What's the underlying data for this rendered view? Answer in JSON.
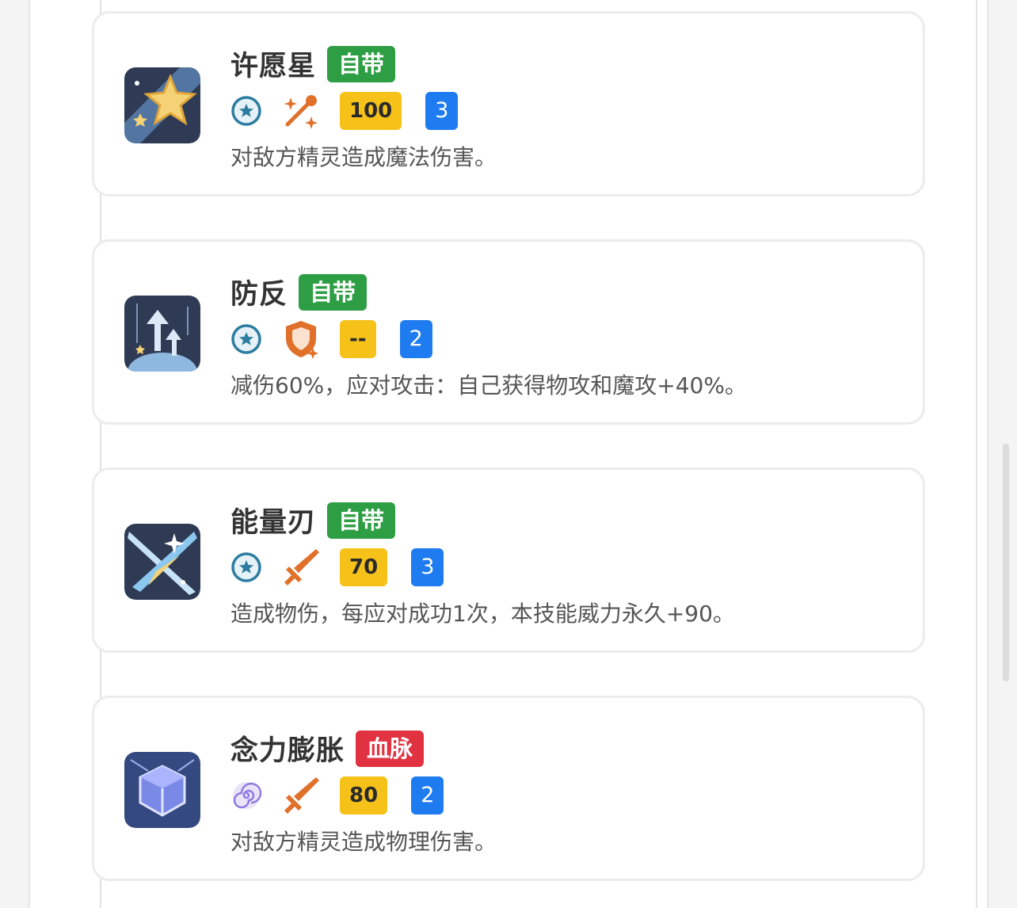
{
  "colors": {
    "tag_self": "#2e9e44",
    "tag_blood": "#e03241",
    "cost_bg": "#f6c21a",
    "pp_bg": "#1f7cf0",
    "type_orange": "#e0702a"
  },
  "skills": [
    {
      "name": "许愿星",
      "tag": "自带",
      "tag_type": "self",
      "element_icon": "star-circle-icon",
      "type_icon": "magic-sparkle-icon",
      "cost": "100",
      "pp": "3",
      "desc": "对敌方精灵造成魔法伤害。",
      "icon": "wish-star-icon"
    },
    {
      "name": "防反",
      "tag": "自带",
      "tag_type": "self",
      "element_icon": "star-circle-icon",
      "type_icon": "shield-icon",
      "cost": "--",
      "pp": "2",
      "desc": "减伤60%，应对攻击：自己获得物攻和魔攻+40%。",
      "icon": "counter-arrows-icon"
    },
    {
      "name": "能量刃",
      "tag": "自带",
      "tag_type": "self",
      "element_icon": "star-circle-icon",
      "type_icon": "sword-icon",
      "cost": "70",
      "pp": "3",
      "desc": "造成物伤，每应对成功1次，本技能威力永久+90。",
      "icon": "energy-blade-icon"
    },
    {
      "name": "念力膨胀",
      "tag": "血脉",
      "tag_type": "blood",
      "element_icon": "psychic-swirl-icon",
      "type_icon": "sword-icon",
      "cost": "80",
      "pp": "2",
      "desc": "对敌方精灵造成物理伤害。",
      "icon": "psychic-cube-icon"
    }
  ]
}
